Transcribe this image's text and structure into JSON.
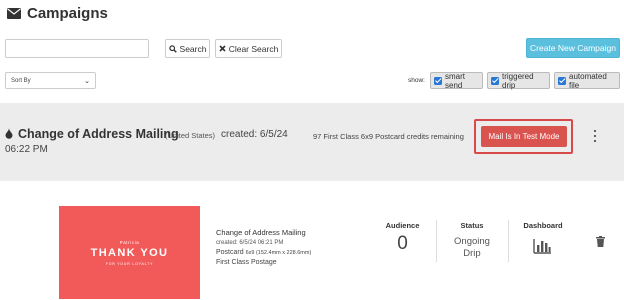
{
  "header": {
    "title": "Campaigns",
    "icon": "envelope-icon"
  },
  "search": {
    "value": "",
    "placeholder": "",
    "search_label": "Search",
    "clear_label": "Clear Search"
  },
  "create_label": "Create New Campaign",
  "sort": {
    "selected": "Sort By"
  },
  "filters": {
    "show_label": "show:",
    "items": [
      {
        "label": "smart send",
        "checked": true
      },
      {
        "label": "triggered drip",
        "checked": true
      },
      {
        "label": "automated file",
        "checked": true
      }
    ]
  },
  "campaign": {
    "name": "Change of Address Mailing",
    "country": "(United States)",
    "created": "created: 6/5/24",
    "time": "06:22 PM",
    "credits": "97 First Class 6x9 Postcard credits remaining",
    "test_mode_label": "Mail Is In Test Mode"
  },
  "postcard": {
    "name_text": "Patricia",
    "main_text": "THANK YOU",
    "sub_text": "FOR YOUR LOYALTY"
  },
  "details": {
    "name": "Change of Address Mailing",
    "created": "created: 6/5/24 06:21 PM",
    "size_main": "Postcard",
    "size_dims": "6x9 (152.4mm x 228.6mm)",
    "postage": "First Class Postage"
  },
  "stats": {
    "audience_label": "Audience",
    "audience_value": "0",
    "status_label": "Status",
    "status_line1": "Ongoing",
    "status_line2": "Drip",
    "dashboard_label": "Dashboard"
  },
  "colors": {
    "accent": "#5bc0de",
    "danger": "#d9534f",
    "postcard": "#f25a5a",
    "panel": "#ececec"
  }
}
